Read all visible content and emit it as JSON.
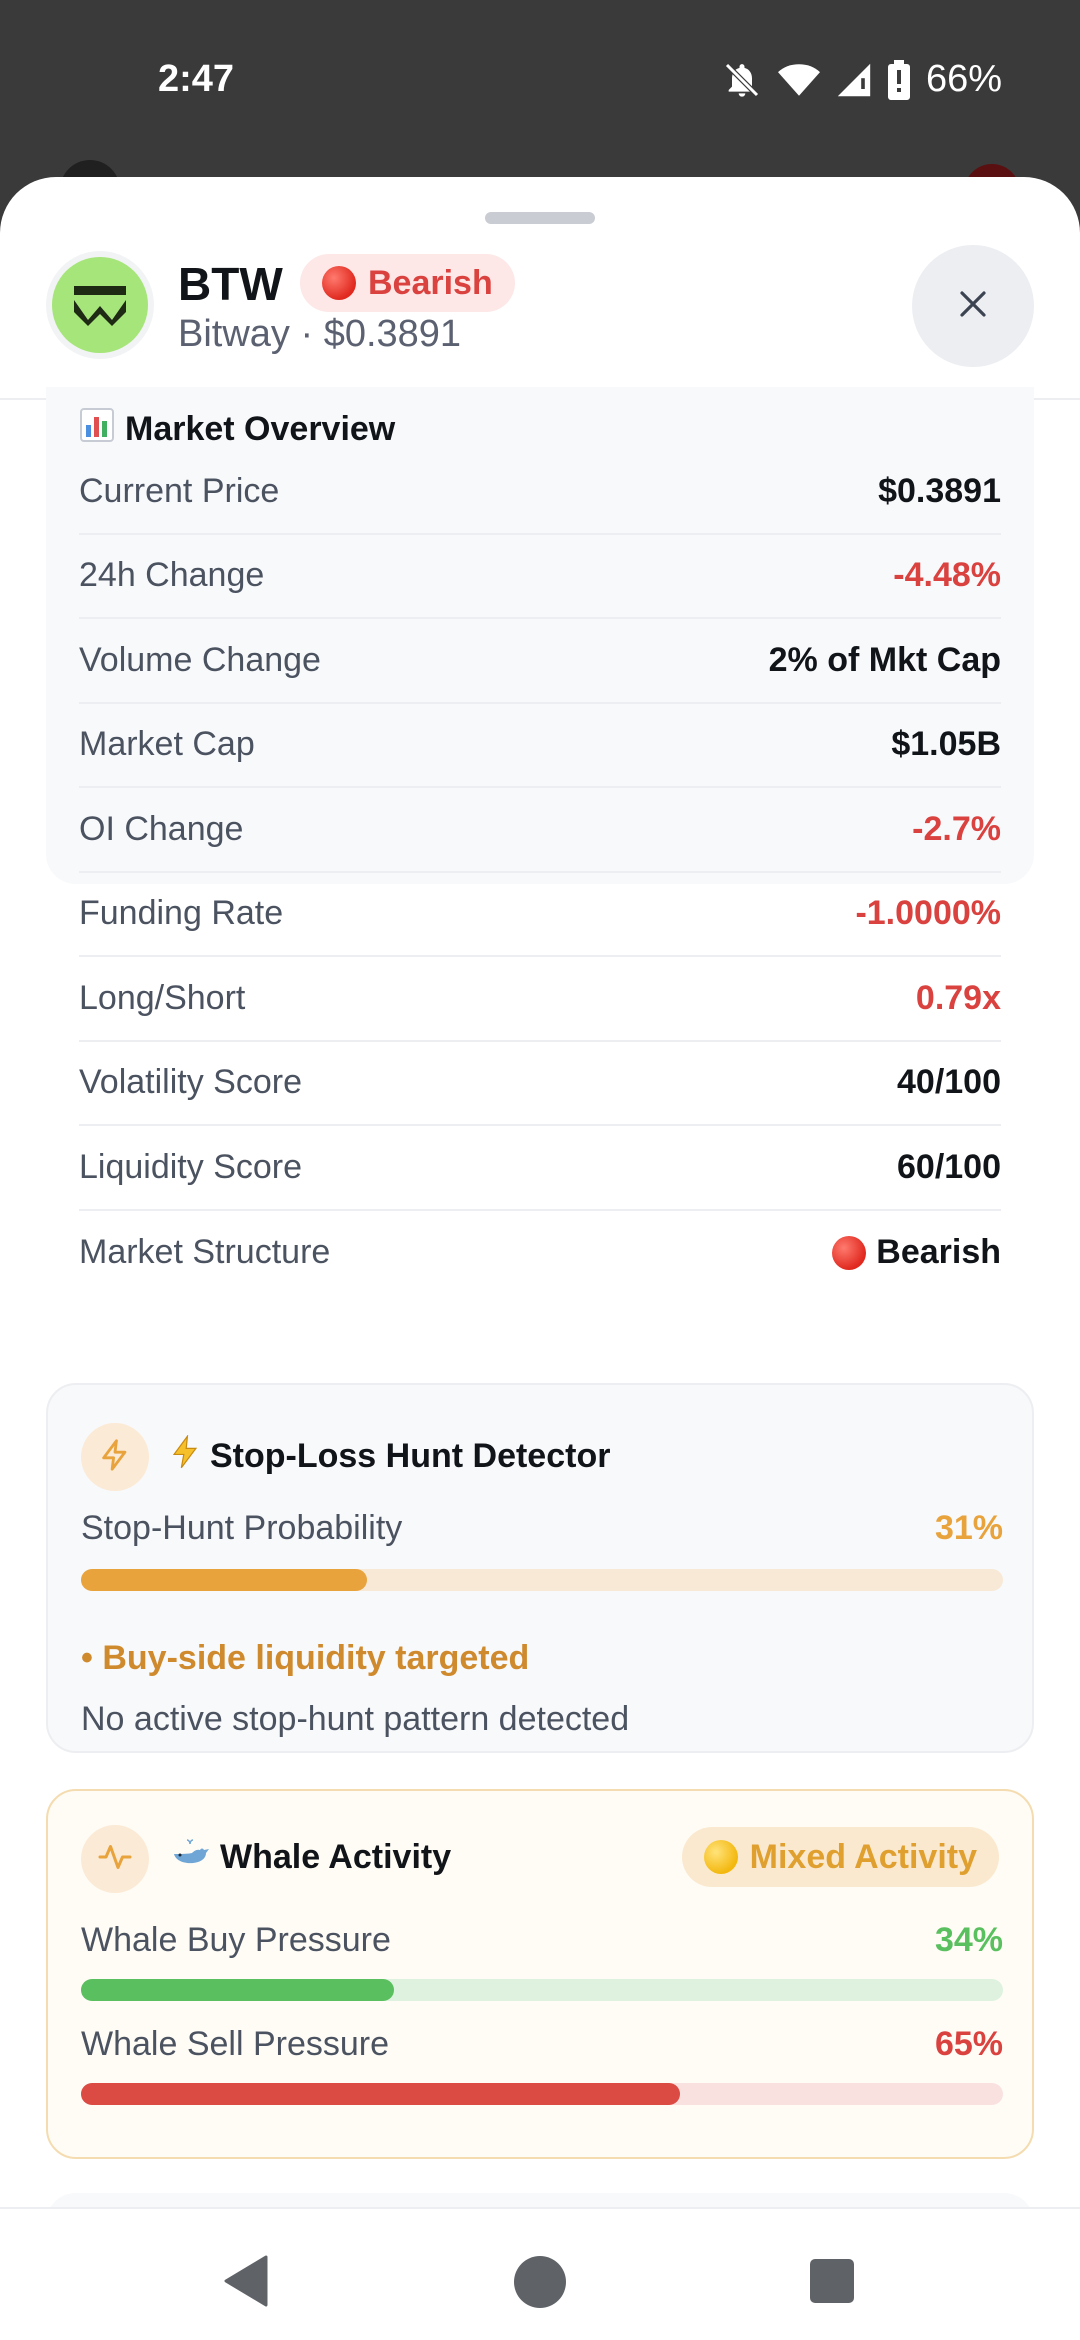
{
  "status_bar": {
    "time": "2:47",
    "battery": "66%"
  },
  "coin": {
    "symbol": "BTW",
    "sentiment_label": "Bearish",
    "subtitle": "Bitway · $0.3891",
    "logo_color": "#a6e57a"
  },
  "market_overview": {
    "title": "Market Overview",
    "rows": [
      {
        "label": "Current Price",
        "value": "$0.3891"
      },
      {
        "label": "24h Change",
        "value": "-4.48%"
      },
      {
        "label": "Volume Change",
        "value": "2% of Mkt Cap"
      },
      {
        "label": "Market Cap",
        "value": "$1.05B"
      },
      {
        "label": "OI Change",
        "value": "-2.7%"
      },
      {
        "label": "Funding Rate",
        "value": "-1.0000%"
      },
      {
        "label": "Long/Short",
        "value": "0.79x"
      },
      {
        "label": "Volatility Score",
        "value": "40/100"
      },
      {
        "label": "Liquidity Score",
        "value": "60/100"
      },
      {
        "label": "Market Structure",
        "value": "Bearish"
      }
    ]
  },
  "stop_hunt": {
    "title": "Stop-Loss Hunt Detector",
    "probability_label": "Stop-Hunt Probability",
    "probability_text": "31%",
    "probability": 0.31,
    "target_note": "• Buy-side liquidity targeted",
    "status": "No active stop-hunt pattern detected"
  },
  "whale": {
    "title": "Whale Activity",
    "badge": "Mixed Activity",
    "buy_label": "Whale Buy Pressure",
    "buy_text": "34%",
    "buy": 0.34,
    "sell_label": "Whale Sell Pressure",
    "sell_text": "65%",
    "sell": 0.65
  },
  "colors": {
    "negative": "#d9423f",
    "positive": "#5ac05f",
    "warning": "#e8a33d"
  }
}
